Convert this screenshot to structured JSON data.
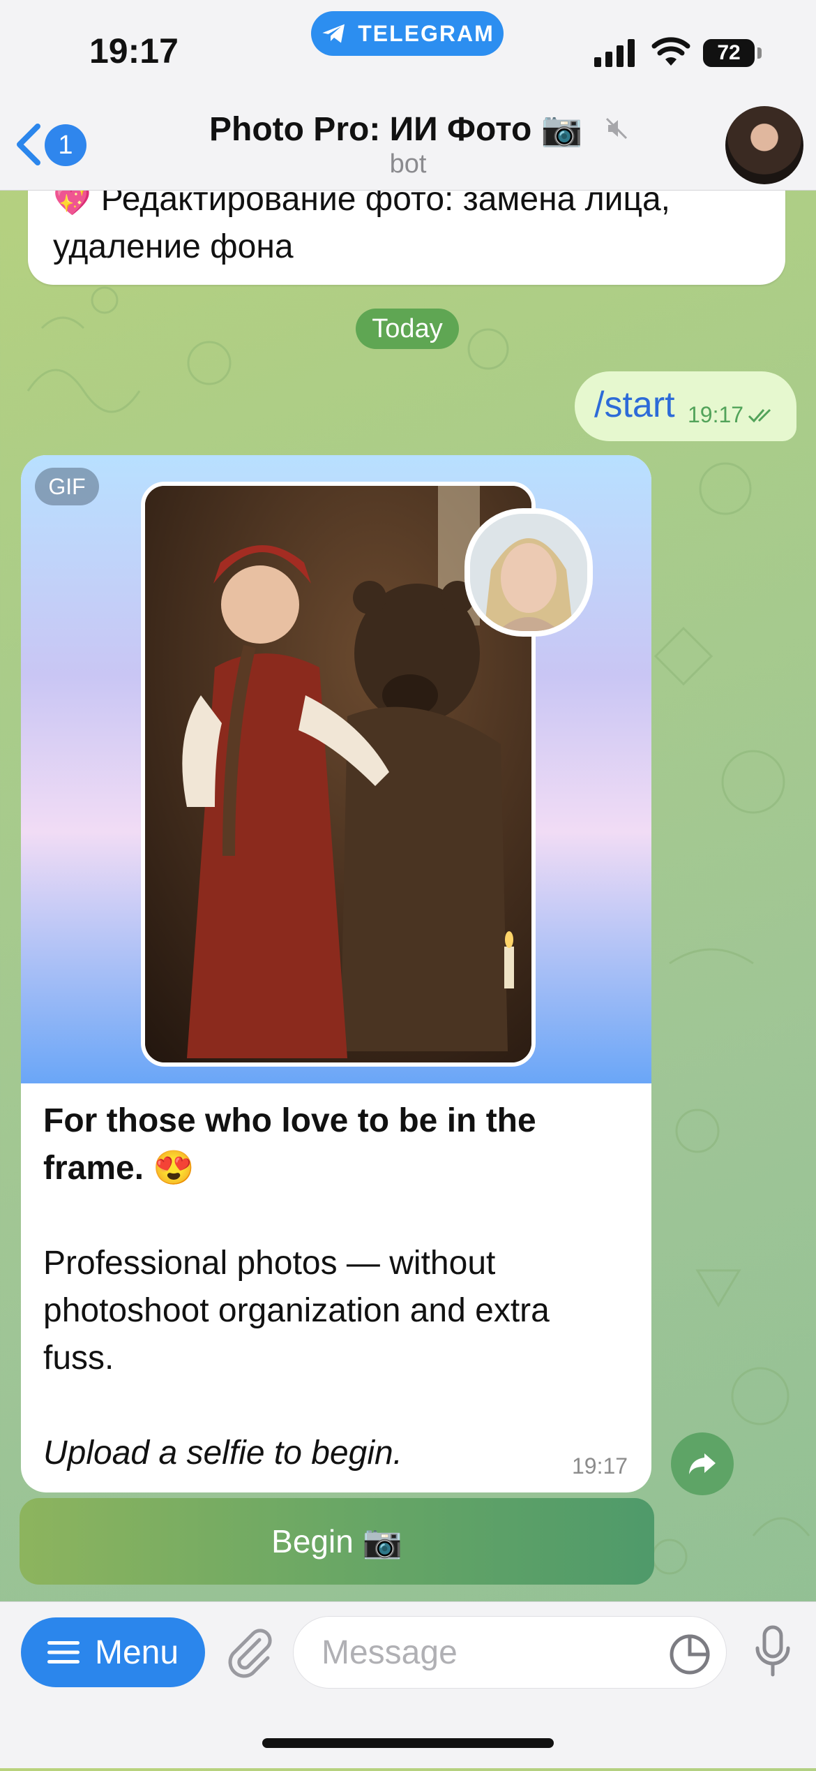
{
  "status": {
    "time": "19:17",
    "battery": "72"
  },
  "banner": {
    "label": "TELEGRAM"
  },
  "header": {
    "back_badge": "1",
    "title": "Photo Pro: ИИ Фото 📷",
    "subtitle": "bot"
  },
  "messages": {
    "previous": {
      "line1": "Редактирование фото: замена лица,",
      "line2": "удаление фона"
    },
    "date_separator": "Today",
    "outgoing": {
      "text": "/start",
      "time": "19:17"
    },
    "incoming": {
      "media_badge": "GIF",
      "headline": "For those who love to be in the frame. 😍",
      "body": "Professional photos — without photoshoot organization and extra fuss.",
      "cta": "Upload a selfie to begin.",
      "time": "19:17"
    },
    "inline_button": "Begin 📷"
  },
  "composer": {
    "menu_label": "Menu",
    "placeholder": "Message"
  },
  "colors": {
    "accent": "#2b86ec",
    "outgoing_bubble": "#e6f8cf",
    "button_green": "#5ea466"
  }
}
